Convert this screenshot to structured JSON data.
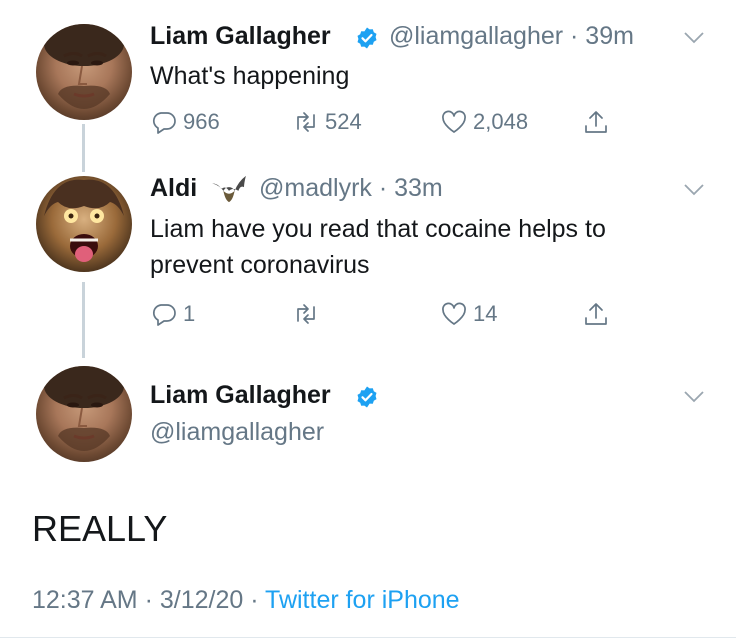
{
  "tweets": [
    {
      "name": "Liam Gallagher",
      "verified": true,
      "handle": "@liamgallagher",
      "time": "39m",
      "text": "What's happening",
      "replies": "966",
      "retweets": "524",
      "likes": "2,048"
    },
    {
      "name": "Aldi",
      "emoji": "bat-emoji",
      "handle": "@madlyrk",
      "time": "33m",
      "text_line1": "Liam have you read that cocaine helps to",
      "text_line2": "prevent coronavirus",
      "replies": "1",
      "retweets": "",
      "likes": "14"
    }
  ],
  "main_tweet": {
    "name": "Liam Gallagher",
    "verified": true,
    "handle": "@liamgallagher",
    "text": "REALLY",
    "time": "12:37 AM",
    "date": "3/12/20",
    "source": "Twitter for iPhone"
  },
  "colors": {
    "accent": "#1da1f2",
    "secondary_text": "#657786",
    "primary_text": "#14171a"
  }
}
